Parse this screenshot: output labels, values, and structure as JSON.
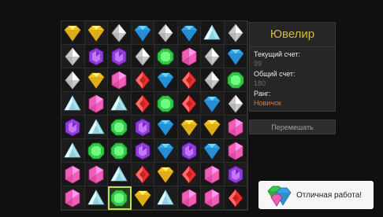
{
  "panel": {
    "title": "Ювелир",
    "current_score_label": "Текущий счет:",
    "current_score_value": "99",
    "total_score_label": "Общий счет:",
    "total_score_value": "180",
    "rank_label": "Ранг:",
    "rank_value": "Новичок"
  },
  "shuffle_button": {
    "label": "Перемешать"
  },
  "toast": {
    "message": "Отличная работа!"
  },
  "board": {
    "selected": [
      7,
      2
    ],
    "rows": [
      [
        "yellow",
        "yellow",
        "silver",
        "blue",
        "silver",
        "blue",
        "cyan",
        "silver"
      ],
      [
        "silver",
        "purple",
        "purple",
        "silver",
        "green",
        "pink",
        "silver",
        "blue"
      ],
      [
        "silver",
        "yellow",
        "pink",
        "red",
        "blue",
        "red",
        "silver",
        "green"
      ],
      [
        "cyan",
        "pink",
        "cyan",
        "red",
        "green",
        "red",
        "blue",
        "silver"
      ],
      [
        "purple",
        "cyan",
        "green",
        "purple",
        "blue",
        "yellow",
        "yellow",
        "pink"
      ],
      [
        "cyan",
        "green",
        "green",
        "purple",
        "blue",
        "purple",
        "blue",
        "pink"
      ],
      [
        "pink",
        "pink",
        "cyan",
        "red",
        "yellow",
        "red",
        "pink",
        "purple"
      ],
      [
        "pink",
        "cyan",
        "green",
        "yellow",
        "cyan",
        "pink",
        "pink",
        "red"
      ]
    ]
  },
  "colors": {
    "yellow": "#f2c12e",
    "silver": "#c9c9c9",
    "blue": "#3aa3e8",
    "cyan": "#a8e4f0",
    "purple": "#8e3fd6",
    "green": "#37c64a",
    "pink": "#ef5fb8",
    "red": "#e03434",
    "accent_title": "#d8b840",
    "rank": "#e07a2a"
  }
}
